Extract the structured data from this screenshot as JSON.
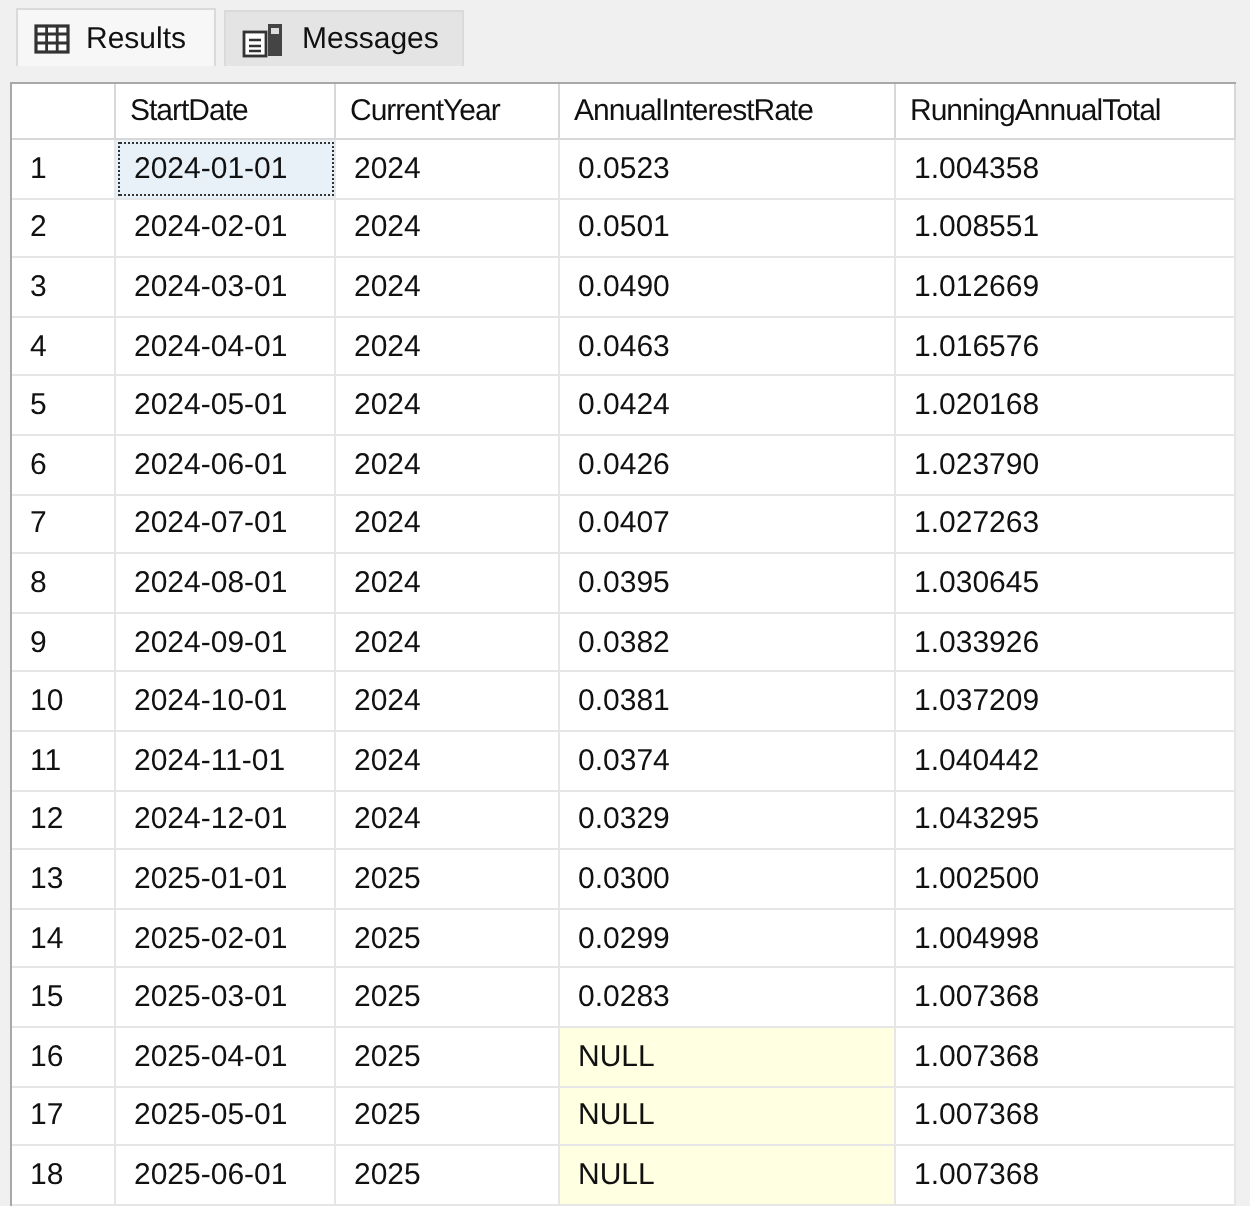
{
  "tabs": [
    {
      "label": "Results",
      "selected": true
    },
    {
      "label": "Messages",
      "selected": false
    }
  ],
  "columns": [
    "StartDate",
    "CurrentYear",
    "AnnualInterestRate",
    "RunningAnnualTotal"
  ],
  "rows": [
    {
      "number": "1",
      "cells": [
        {
          "text": "2024-01-01",
          "focused": true,
          "null": false
        },
        {
          "text": "2024",
          "focused": false,
          "null": false
        },
        {
          "text": "0.0523",
          "focused": false,
          "null": false
        },
        {
          "text": "1.004358",
          "focused": false,
          "null": false
        }
      ]
    },
    {
      "number": "2",
      "cells": [
        {
          "text": "2024-02-01",
          "focused": false,
          "null": false
        },
        {
          "text": "2024",
          "focused": false,
          "null": false
        },
        {
          "text": "0.0501",
          "focused": false,
          "null": false
        },
        {
          "text": "1.008551",
          "focused": false,
          "null": false
        }
      ]
    },
    {
      "number": "3",
      "cells": [
        {
          "text": "2024-03-01",
          "focused": false,
          "null": false
        },
        {
          "text": "2024",
          "focused": false,
          "null": false
        },
        {
          "text": "0.0490",
          "focused": false,
          "null": false
        },
        {
          "text": "1.012669",
          "focused": false,
          "null": false
        }
      ]
    },
    {
      "number": "4",
      "cells": [
        {
          "text": "2024-04-01",
          "focused": false,
          "null": false
        },
        {
          "text": "2024",
          "focused": false,
          "null": false
        },
        {
          "text": "0.0463",
          "focused": false,
          "null": false
        },
        {
          "text": "1.016576",
          "focused": false,
          "null": false
        }
      ]
    },
    {
      "number": "5",
      "cells": [
        {
          "text": "2024-05-01",
          "focused": false,
          "null": false
        },
        {
          "text": "2024",
          "focused": false,
          "null": false
        },
        {
          "text": "0.0424",
          "focused": false,
          "null": false
        },
        {
          "text": "1.020168",
          "focused": false,
          "null": false
        }
      ]
    },
    {
      "number": "6",
      "cells": [
        {
          "text": "2024-06-01",
          "focused": false,
          "null": false
        },
        {
          "text": "2024",
          "focused": false,
          "null": false
        },
        {
          "text": "0.0426",
          "focused": false,
          "null": false
        },
        {
          "text": "1.023790",
          "focused": false,
          "null": false
        }
      ]
    },
    {
      "number": "7",
      "cells": [
        {
          "text": "2024-07-01",
          "focused": false,
          "null": false
        },
        {
          "text": "2024",
          "focused": false,
          "null": false
        },
        {
          "text": "0.0407",
          "focused": false,
          "null": false
        },
        {
          "text": "1.027263",
          "focused": false,
          "null": false
        }
      ]
    },
    {
      "number": "8",
      "cells": [
        {
          "text": "2024-08-01",
          "focused": false,
          "null": false
        },
        {
          "text": "2024",
          "focused": false,
          "null": false
        },
        {
          "text": "0.0395",
          "focused": false,
          "null": false
        },
        {
          "text": "1.030645",
          "focused": false,
          "null": false
        }
      ]
    },
    {
      "number": "9",
      "cells": [
        {
          "text": "2024-09-01",
          "focused": false,
          "null": false
        },
        {
          "text": "2024",
          "focused": false,
          "null": false
        },
        {
          "text": "0.0382",
          "focused": false,
          "null": false
        },
        {
          "text": "1.033926",
          "focused": false,
          "null": false
        }
      ]
    },
    {
      "number": "10",
      "cells": [
        {
          "text": "2024-10-01",
          "focused": false,
          "null": false
        },
        {
          "text": "2024",
          "focused": false,
          "null": false
        },
        {
          "text": "0.0381",
          "focused": false,
          "null": false
        },
        {
          "text": "1.037209",
          "focused": false,
          "null": false
        }
      ]
    },
    {
      "number": "11",
      "cells": [
        {
          "text": "2024-11-01",
          "focused": false,
          "null": false
        },
        {
          "text": "2024",
          "focused": false,
          "null": false
        },
        {
          "text": "0.0374",
          "focused": false,
          "null": false
        },
        {
          "text": "1.040442",
          "focused": false,
          "null": false
        }
      ]
    },
    {
      "number": "12",
      "cells": [
        {
          "text": "2024-12-01",
          "focused": false,
          "null": false
        },
        {
          "text": "2024",
          "focused": false,
          "null": false
        },
        {
          "text": "0.0329",
          "focused": false,
          "null": false
        },
        {
          "text": "1.043295",
          "focused": false,
          "null": false
        }
      ]
    },
    {
      "number": "13",
      "cells": [
        {
          "text": "2025-01-01",
          "focused": false,
          "null": false
        },
        {
          "text": "2025",
          "focused": false,
          "null": false
        },
        {
          "text": "0.0300",
          "focused": false,
          "null": false
        },
        {
          "text": "1.002500",
          "focused": false,
          "null": false
        }
      ]
    },
    {
      "number": "14",
      "cells": [
        {
          "text": "2025-02-01",
          "focused": false,
          "null": false
        },
        {
          "text": "2025",
          "focused": false,
          "null": false
        },
        {
          "text": "0.0299",
          "focused": false,
          "null": false
        },
        {
          "text": "1.004998",
          "focused": false,
          "null": false
        }
      ]
    },
    {
      "number": "15",
      "cells": [
        {
          "text": "2025-03-01",
          "focused": false,
          "null": false
        },
        {
          "text": "2025",
          "focused": false,
          "null": false
        },
        {
          "text": "0.0283",
          "focused": false,
          "null": false
        },
        {
          "text": "1.007368",
          "focused": false,
          "null": false
        }
      ]
    },
    {
      "number": "16",
      "cells": [
        {
          "text": "2025-04-01",
          "focused": false,
          "null": false
        },
        {
          "text": "2025",
          "focused": false,
          "null": false
        },
        {
          "text": "NULL",
          "focused": false,
          "null": true
        },
        {
          "text": "1.007368",
          "focused": false,
          "null": false
        }
      ]
    },
    {
      "number": "17",
      "cells": [
        {
          "text": "2025-05-01",
          "focused": false,
          "null": false
        },
        {
          "text": "2025",
          "focused": false,
          "null": false
        },
        {
          "text": "NULL",
          "focused": false,
          "null": true
        },
        {
          "text": "1.007368",
          "focused": false,
          "null": false
        }
      ]
    },
    {
      "number": "18",
      "cells": [
        {
          "text": "2025-06-01",
          "focused": false,
          "null": false
        },
        {
          "text": "2025",
          "focused": false,
          "null": false
        },
        {
          "text": "NULL",
          "focused": false,
          "null": true
        },
        {
          "text": "1.007368",
          "focused": false,
          "null": false
        }
      ]
    }
  ]
}
